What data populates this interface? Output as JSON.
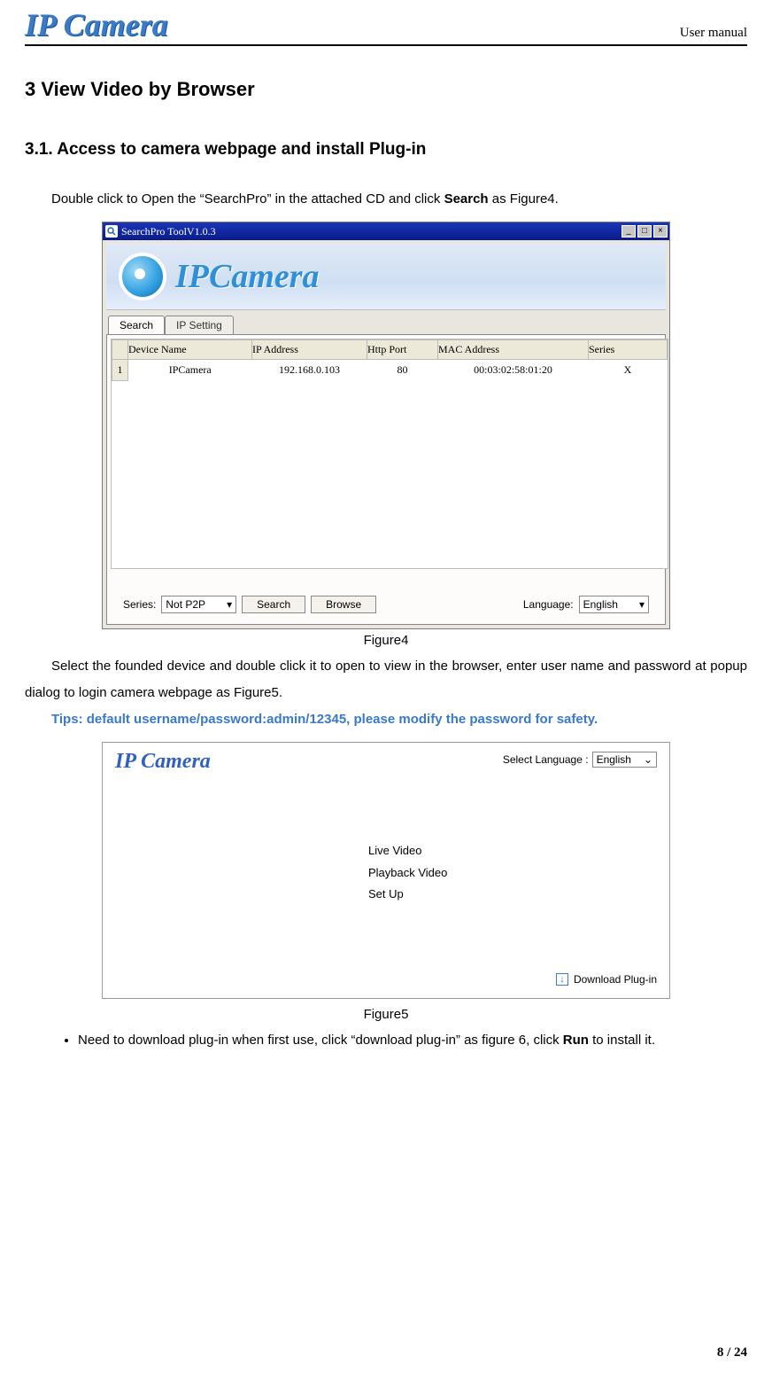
{
  "header": {
    "logo": "IP Camera",
    "right": "User manual"
  },
  "h2": "3  View Video by Browser",
  "h3": "3.1. Access to camera webpage and install Plug-in",
  "p1_pre": "Double click to Open the “SearchPro” in the attached CD and click ",
  "p1_bold": "Search",
  "p1_post": " as Figure4.",
  "fig4": {
    "title": "SearchPro ToolV1.0.3",
    "banner": "IPCamera",
    "tab1": "Search",
    "tab2": "IP Setting",
    "cols": {
      "num": "",
      "c1": "Device Name",
      "c2": "IP Address",
      "c3": "Http Port",
      "c4": "MAC Address",
      "c5": "Series"
    },
    "row": {
      "num": "1",
      "c1": "IPCamera",
      "c2": "192.168.0.103",
      "c3": "80",
      "c4": "00:03:02:58:01:20",
      "c5": "X"
    },
    "series_label": "Series:",
    "series_value": "Not P2P",
    "btn_search": "Search",
    "btn_browse": "Browse",
    "lang_label": "Language:",
    "lang_value": "English",
    "caption": "Figure4"
  },
  "p2": "Select the founded device and double click it to open to view in the browser, enter user name and password at popup dialog to login camera webpage as Figure5.",
  "tips": "Tips: default username/password:admin/12345, please modify the password for safety.",
  "fig5": {
    "logo": "IP Camera",
    "lang_label": "Select Language :",
    "lang_value": "English",
    "menu1": "Live Video",
    "menu2": "Playback Video",
    "menu3": "Set Up",
    "download": "Download Plug-in",
    "caption": "Figure5"
  },
  "bullet_pre": "Need to download plug-in when first use, click “download plug-in” as figure 6, click ",
  "bullet_bold": "Run",
  "bullet_post": " to install it.",
  "footer": "8 / 24"
}
